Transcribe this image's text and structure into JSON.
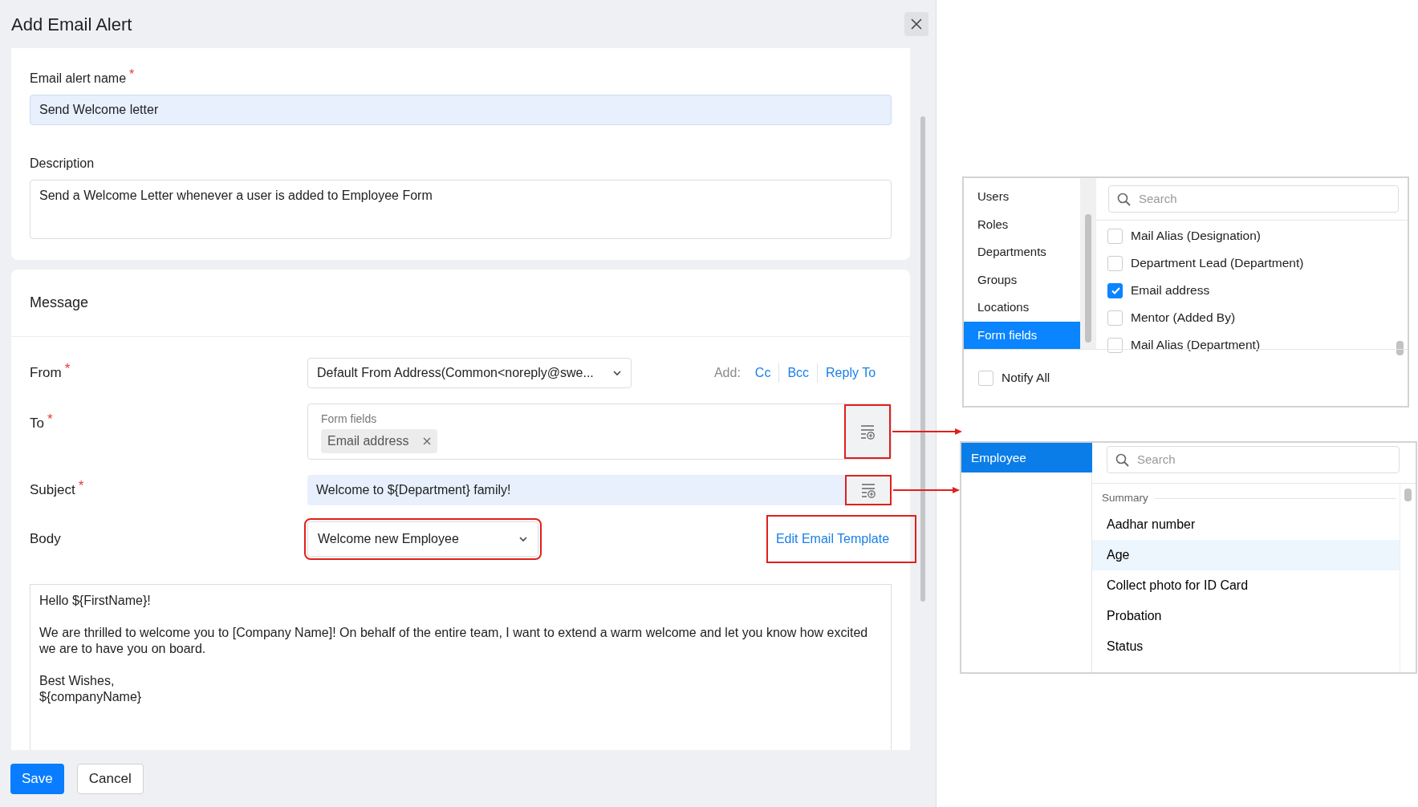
{
  "dialog": {
    "title": "Add Email Alert"
  },
  "alert_name": {
    "label": "Email alert name",
    "required_mark": "*",
    "value": "Send Welcome letter"
  },
  "description": {
    "label": "Description",
    "value": "Send a Welcome Letter whenever a user is added to Employee Form"
  },
  "message": {
    "title": "Message",
    "from": {
      "label": "From",
      "required_mark": "*",
      "value": "Default From Address(Common<noreply@swe...",
      "add_label": "Add:",
      "add_links": [
        "Cc",
        "Bcc",
        "Reply To"
      ]
    },
    "to": {
      "label": "To",
      "required_mark": "*",
      "group_label": "Form fields",
      "tokens": [
        "Email address"
      ],
      "highlighted": true
    },
    "subject": {
      "label": "Subject",
      "required_mark": "*",
      "value": "Welcome to ${Department} family!",
      "highlighted": true
    },
    "body": {
      "label": "Body",
      "template": "Welcome new Employee",
      "highlighted": true,
      "edit_link": {
        "label": "Edit Email Template",
        "highlighted": true
      },
      "lines": [
        "Hello ${FirstName}!",
        "We are thrilled to welcome you to [Company Name]! On behalf of the entire team, I want to extend a warm welcome and let you know how excited we are to have you on board.",
        "Best Wishes,",
        "${companyName}"
      ]
    }
  },
  "buttons": [
    {
      "label": "Save",
      "kind": "primary"
    },
    {
      "label": "Cancel",
      "kind": "secondary"
    }
  ],
  "recipient_picker": {
    "categories": [
      {
        "label": "Users",
        "selected": false
      },
      {
        "label": "Roles",
        "selected": false
      },
      {
        "label": "Departments",
        "selected": false
      },
      {
        "label": "Groups",
        "selected": false
      },
      {
        "label": "Locations",
        "selected": false
      },
      {
        "label": "Form fields",
        "selected": true
      }
    ],
    "search_placeholder": "Search",
    "options": [
      {
        "label": "Mail Alias (Designation)",
        "checked": false
      },
      {
        "label": "Department Lead (Department)",
        "checked": false
      },
      {
        "label": "Email address",
        "checked": true
      },
      {
        "label": "Mentor (Added By)",
        "checked": false
      },
      {
        "label": "Mail Alias (Department)",
        "checked": false
      }
    ],
    "notify_all": {
      "label": "Notify All",
      "checked": false
    }
  },
  "field_picker": {
    "forms": [
      {
        "label": "Employee",
        "selected": true
      }
    ],
    "search_placeholder": "Search",
    "section_title": "Summary",
    "fields": [
      {
        "label": "Aadhar number",
        "selected": false
      },
      {
        "label": "Age",
        "selected": true
      },
      {
        "label": "Collect photo for ID Card",
        "selected": false
      },
      {
        "label": "Probation",
        "selected": false
      },
      {
        "label": "Status",
        "selected": false
      }
    ]
  }
}
